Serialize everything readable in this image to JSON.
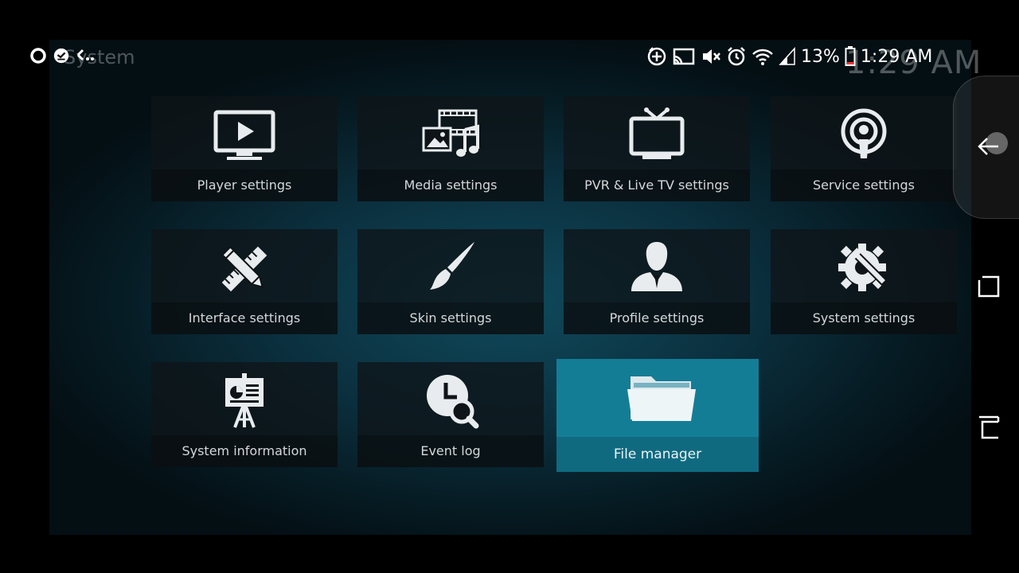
{
  "app": {
    "section_title": "System",
    "focused_item": "File manager"
  },
  "status_bar": {
    "battery_percent": "13%",
    "time": "1:29 AM",
    "faint_time": "1:29 AM",
    "icons": [
      "circle-icon",
      "download-done-icon",
      "dots-icon",
      "add-circle-icon",
      "cast-icon",
      "mute-icon",
      "alarm-icon",
      "wifi-icon",
      "signal-icon",
      "battery-icon"
    ]
  },
  "tiles": [
    {
      "label": "Player settings",
      "icon": "tv-play-icon"
    },
    {
      "label": "Media settings",
      "icon": "media-icon"
    },
    {
      "label": "PVR & Live TV settings",
      "icon": "tv-antenna-icon"
    },
    {
      "label": "Service settings",
      "icon": "podcast-icon"
    },
    {
      "label": "Interface settings",
      "icon": "pencil-ruler-icon"
    },
    {
      "label": "Skin settings",
      "icon": "paintbrush-icon"
    },
    {
      "label": "Profile settings",
      "icon": "user-icon"
    },
    {
      "label": "System settings",
      "icon": "gear-wrench-icon"
    },
    {
      "label": "System information",
      "icon": "presentation-board-icon"
    },
    {
      "label": "Event log",
      "icon": "clock-search-icon"
    },
    {
      "label": "File manager",
      "icon": "folder-icon"
    }
  ],
  "android_nav": {
    "buttons": [
      "back-icon",
      "recents-icon",
      "home-icon"
    ]
  },
  "colors": {
    "focus": "#147d96",
    "tile": "#0e1418",
    "text": "#d3d8da"
  }
}
